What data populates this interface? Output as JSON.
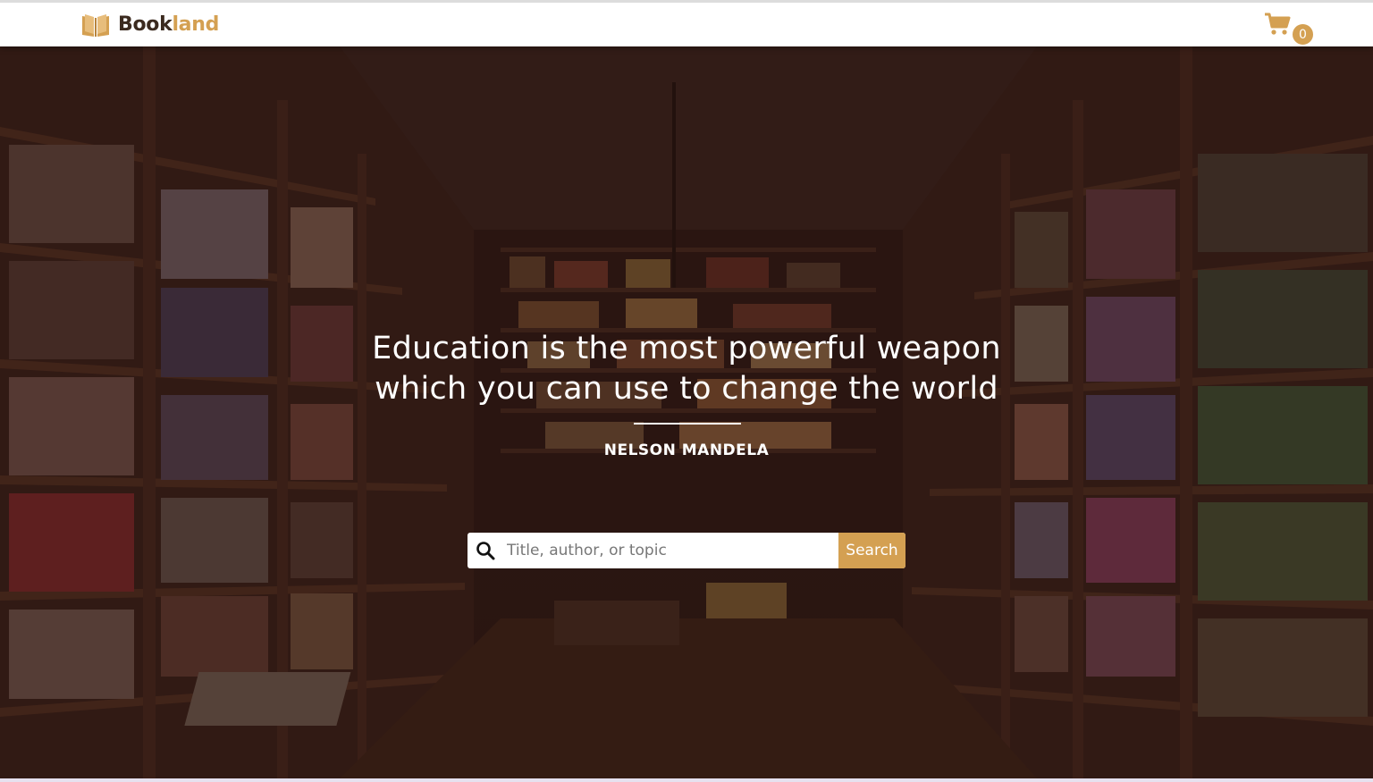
{
  "brand": {
    "name_part1": "Book",
    "name_part2": "land",
    "logo_icon": "open-book-icon",
    "accent_color": "#d4a052",
    "dark_color": "#3b2a1f"
  },
  "cart": {
    "icon": "shopping-cart-icon",
    "count": "0"
  },
  "hero": {
    "quote_line1": "Education is the most powerful weapon",
    "quote_line2": "which you can use to change the world",
    "author": "NELSON MANDELA"
  },
  "search": {
    "icon": "search-icon",
    "placeholder": "Title, author, or topic",
    "value": "",
    "button_label": "Search"
  }
}
